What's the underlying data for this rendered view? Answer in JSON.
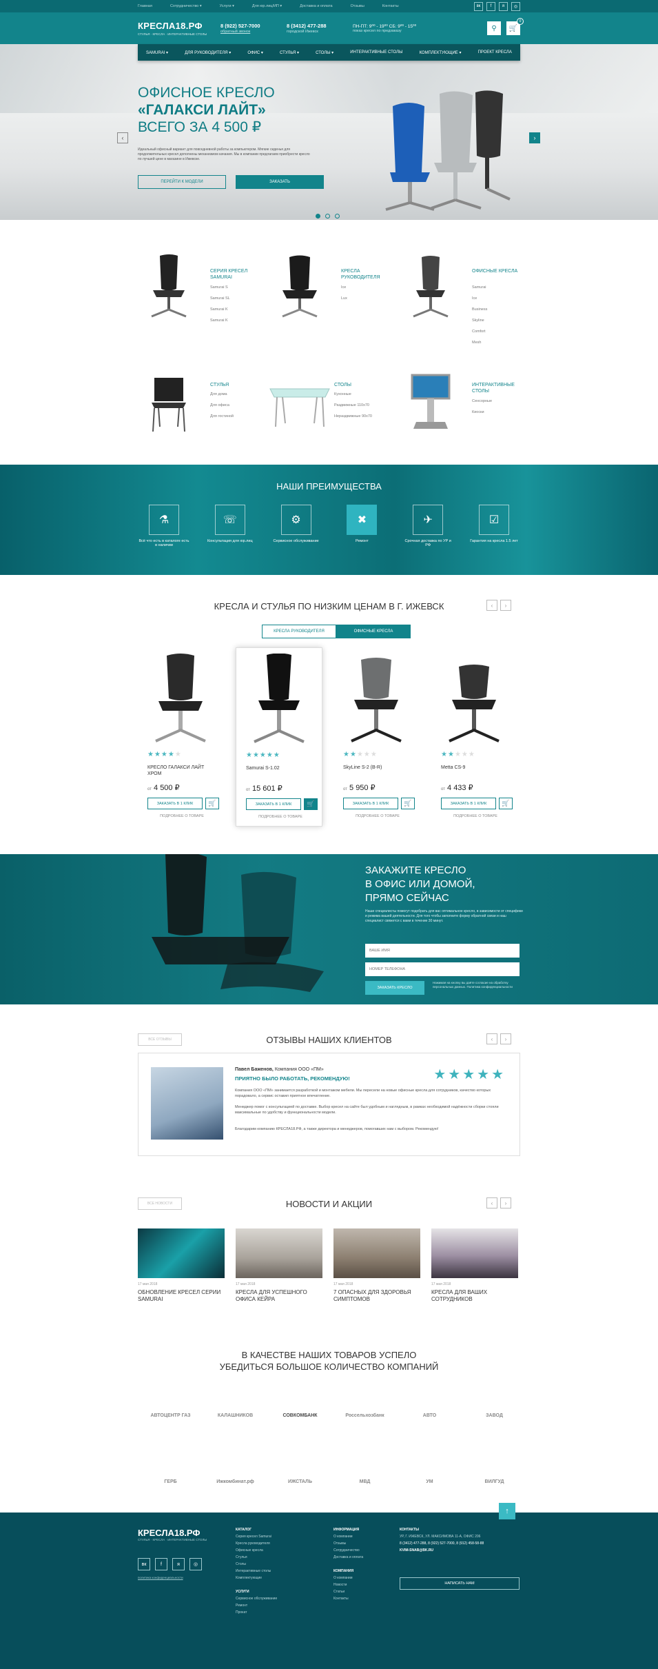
{
  "topbar": {
    "links": [
      "Главная",
      "Сотрудничество ▾",
      "Услуги ▾",
      "Для юр.лиц/ИП ▾",
      "Доставка и оплата",
      "Отзывы",
      "Контакты"
    ],
    "social": [
      "вк",
      "f",
      "я",
      "◎"
    ]
  },
  "header": {
    "logo": "КРЕСЛА18.РФ",
    "logo_sub": "СТУЛЬЯ · КРЕСЛА · ИНТЕРАКТИВНЫЕ СТОЛЫ",
    "phone1": "8 (922) 527-7000",
    "callback": "обратный звонок",
    "phone2": "8 (3412) 477-288",
    "phone2_note": "городской Ижевск",
    "hours": "ПН-ПТ: 9⁰⁰ - 19⁰⁰  СБ: 9⁰⁰ - 15⁰⁰",
    "hours_note": "показ кресел по предзаказу",
    "cart_count": "0"
  },
  "nav": [
    "SAMURAI ▾",
    "ДЛЯ РУКОВОДИТЕЛЯ ▾",
    "ОФИС ▾",
    "СТУЛЬЯ ▾",
    "СТОЛЫ ▾",
    "ИНТЕРАКТИВНЫЕ СТОЛЫ",
    "КОМПЛЕКТУЮЩИЕ ▾",
    "ПРОЕКТ КРЕСЛА"
  ],
  "hero": {
    "line1": "ОФИСНОЕ КРЕСЛО",
    "line2": "«ГАЛАКСИ ЛАЙТ»",
    "line3": "ВСЕГО ЗА 4 500 ₽",
    "desc": "Идеальный офисный вариант для повседневной работы за компьютером. Мягкие сиденья для продолжительных кресел дополнены механизмом качания. Мы в компании предлагаем приобрести кресло по лучшей цене в магазине в Ижевске.",
    "btn_model": "ПЕРЕЙТИ К МОДЕЛИ",
    "btn_order": "ЗАКАЗАТЬ"
  },
  "categories": [
    {
      "title": "СЕРИЯ КРЕСЕЛ SAMURAI",
      "items": [
        "Samurai S",
        "Samurai SL",
        "Samurai K",
        "Samurai K"
      ]
    },
    {
      "title": "КРЕСЛА РУКОВОДИТЕЛЯ",
      "items": [
        "Ice",
        "Lux"
      ]
    },
    {
      "title": "ОФИСНЫЕ КРЕСЛА",
      "items": [
        "Samurai",
        "Ice",
        "Business",
        "Skyline",
        "Comfort",
        "Mesh"
      ]
    },
    {
      "title": "СТУЛЬЯ",
      "items": [
        "Для дома",
        "Для офиса",
        "Для гостиной"
      ]
    },
    {
      "title": "СТОЛЫ",
      "items": [
        "Кухонные",
        "Раздвижные 110х70",
        "Нераздвижные 90х70"
      ]
    },
    {
      "title": "ИНТЕРАКТИВНЫЕ СТОЛЫ",
      "items": [
        "Сенсорные",
        "Киоски"
      ]
    }
  ],
  "advantages": {
    "title": "НАШИ ПРЕИМУЩЕСТВА",
    "items": [
      {
        "label": "Всё что есть в каталоге есть в наличии"
      },
      {
        "label": "Консультация для юр.лиц"
      },
      {
        "label": "Сервисное обслуживание"
      },
      {
        "label": "Ремонт"
      },
      {
        "label": "Срочная доставка по УР и РФ"
      },
      {
        "label": "Гарантия на кресла 1.5 лет"
      }
    ]
  },
  "products": {
    "title": "КРЕСЛА И СТУЛЬЯ ПО НИЗКИМ ЦЕНАМ В Г. ИЖЕВСК",
    "tab1": "КРЕСЛА РУКОВОДИТЕЛЯ",
    "tab2": "ОФИСНЫЕ КРЕСЛА",
    "from": "от",
    "buy": "ЗАКАЗАТЬ В 1 КЛИК",
    "compare": "ПОДРОБНЕЕ О ТОВАРЕ",
    "items": [
      {
        "name": "КРЕСЛО ГАЛАКСИ ЛАЙТ ХРОМ",
        "price": "4 500 ₽",
        "rating": 4
      },
      {
        "name": "Samurai S-1.02",
        "price": "15 601 ₽",
        "rating": 5
      },
      {
        "name": "SkyLine S-2 (B-R)",
        "price": "5 950 ₽",
        "rating": 2
      },
      {
        "name": "Metta CS-9",
        "price": "4 433 ₽",
        "rating": 2
      }
    ]
  },
  "order": {
    "title1": "ЗАКАЖИТЕ КРЕСЛО",
    "title2": "В ОФИС ИЛИ ДОМОЙ,",
    "title3": "ПРЯМО СЕЙЧАС",
    "text": "Наши специалисты помогут подобрать для вас оптимальное кресло, в зависимости от специфики и режима вашей деятельности. Для того чтобы заполните форму обратной связи и наш специалист свяжется с вами в течение 30 минут.",
    "name_ph": "ВАШЕ ИМЯ",
    "phone_ph": "НОМЕР ТЕЛЕФОНА",
    "btn": "ЗАКАЗАТЬ КРЕСЛО",
    "note": "Нажимая на кнопку вы даёте согласие на обработку персональных данных. Политика конфиденциальности"
  },
  "reviews": {
    "tag": "ВСЕ ОТЗЫВЫ",
    "title": "ОТЗЫВЫ НАШИХ КЛИЕНТОВ",
    "author": "Павел Баженов,",
    "company": " Компания ООО «ПМ»",
    "headline": "ПРИЯТНО БЫЛО РАБОТАТЬ, РЕКОМЕНДУЮ!",
    "p1": "Компания ООО «ПМ» занимается разработкой и монтажом мебели. Мы пересели на новые офисные кресла для сотрудников, качество которых порадовало, а сервис оставил приятное впечатление.",
    "p2": "Менеджер помог с консультацией по доставке. Выбор кресел на сайте был удобным и наглядным, в рамках необходимой надёжности сборки стояли максимальные по удобству и функциональности модели.",
    "p3": "Благодарим компанию КРЕСЛА18.РФ, а также директора и менеджеров, помогавших нам с выбором. Рекомендую!"
  },
  "news": {
    "tag": "ВСЕ НОВОСТИ",
    "title": "НОВОСТИ И АКЦИИ",
    "items": [
      {
        "date": "17 мая 2018",
        "title": "ОБНОВЛЕНИЕ КРЕСЕЛ СЕРИИ SAMURAI"
      },
      {
        "date": "17 мая 2018",
        "title": "КРЕСЛА ДЛЯ УСПЕШНОГО ОФИСА КЕЙРА"
      },
      {
        "date": "17 мая 2018",
        "title": "7 ОПАСНЫХ ДЛЯ ЗДОРОВЬЯ СИМПТОМОВ"
      },
      {
        "date": "17 мая 2018",
        "title": "КРЕСЛА ДЛЯ ВАШИХ СОТРУДНИКОВ"
      }
    ]
  },
  "partners": {
    "title1": "В КАЧЕСТВЕ НАШИХ ТОВАРОВ УСПЕЛО",
    "title2": "УБЕДИТЬСЯ БОЛЬШОЕ КОЛИЧЕСТВО КОМПАНИЙ",
    "row1": [
      "АВТОЦЕНТР ГАЗ",
      "КАЛАШНИКОВ",
      "СОВКОМБАНК",
      "Россельхозбанк",
      "АВТО",
      "ЗАВОД"
    ],
    "row2": [
      "ГЕРБ",
      "Ижкомбинат.рф",
      "ИЖСТАЛЬ",
      "МВД",
      "УМ",
      "ВИЛГУД"
    ]
  },
  "footer": {
    "logo": "КРЕСЛА18.РФ",
    "logo_sub": "СТУЛЬЯ · КРЕСЛА · ИНТЕРАКТИВНЫЕ СТОЛЫ",
    "social": [
      "вк",
      "f",
      "я",
      "◎"
    ],
    "policy": "политика конфиденциальности",
    "catalog_h": "КАТАЛОГ",
    "catalog": [
      "Серия кресел Samurai",
      "Кресла руководителя",
      "Офисные кресла",
      "Стулья",
      "Столы",
      "Интерактивные столы",
      "Комплектующие"
    ],
    "services_h": "УСЛУГИ",
    "services": [
      "Сервисное обслуживание",
      "Ремонт",
      "Прокат"
    ],
    "info_h": "ИНФОРМАЦИЯ",
    "info": [
      "О компании",
      "Отзывы",
      "Сотрудничество",
      "Доставка и оплата"
    ],
    "company_h": "КОМПАНИЯ",
    "company": [
      "О компании",
      "Новости",
      "Статьи",
      "Контакты"
    ],
    "contacts_h": "КОНТАКТЫ",
    "address": "УР, Г. ИЖЕВСК, УЛ. МАКСИМОВА 11-А, ОФИС 206",
    "phones": "8 (3412) 477-288, 8 (922) 527-7000, 8 (912) 458-58-88",
    "email": "KVIM-SNAB@BK.RU",
    "write": "НАПИСАТЬ НАМ"
  }
}
